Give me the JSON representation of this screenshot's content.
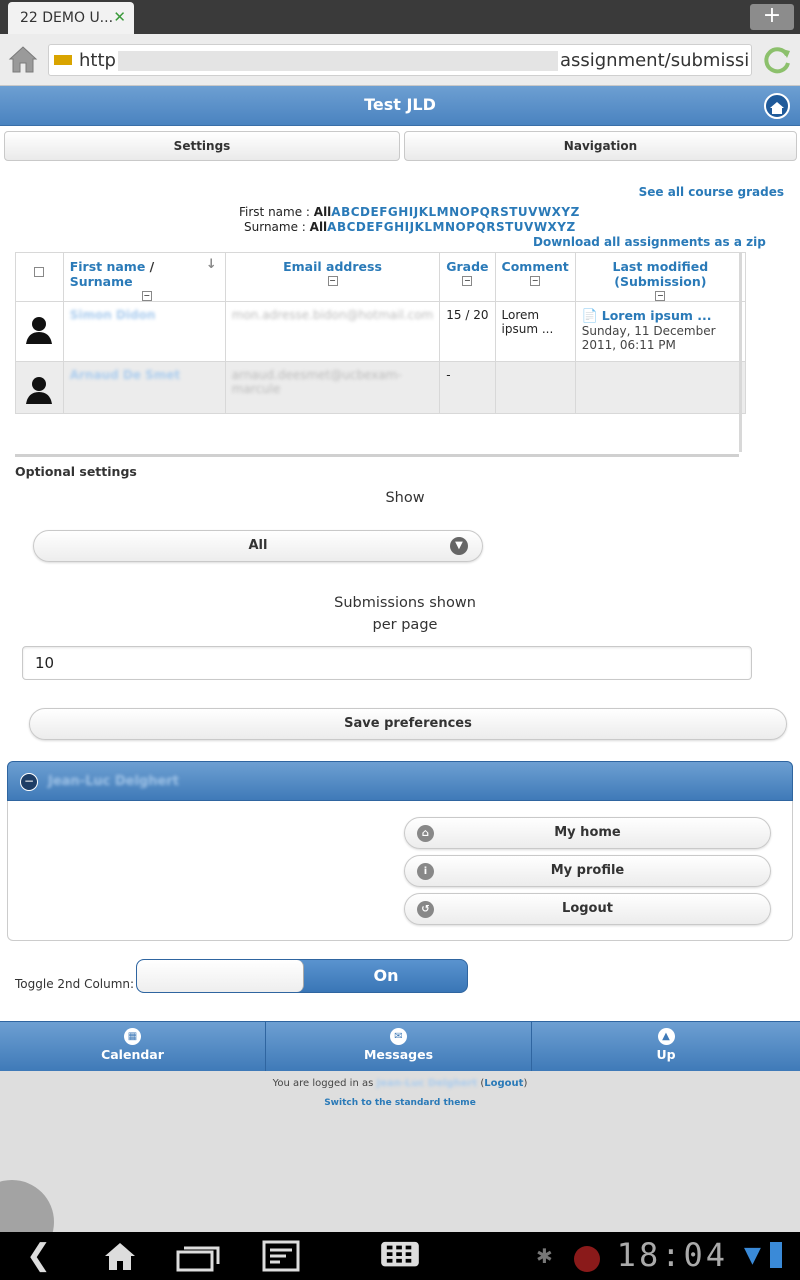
{
  "browser": {
    "tab_title": "22 DEMO U...",
    "tab_close": "✕",
    "new_tab": "+",
    "url_start": "http",
    "url_end": "assignment/submissi..."
  },
  "header": {
    "title": "Test JLD",
    "settings_label": "Settings",
    "navigation_label": "Navigation"
  },
  "links": {
    "course_grades": "See all course grades",
    "download_zip": "Download all assignments as a zip"
  },
  "filters": {
    "firstname_label": "First name : ",
    "surname_label": "Surname : ",
    "all": "All",
    "letters": "ABCDEFGHIJKLMNOPQRSTUVWXYZ"
  },
  "table": {
    "col_firstname": "First name",
    "col_sep": " / ",
    "col_surname": "Surname",
    "col_email": "Email address",
    "col_grade": "Grade",
    "col_comment": "Comment",
    "col_modified": "Last modified (Submission)",
    "collapse": "−",
    "rows": [
      {
        "name": "Simon Didon",
        "email": "mon.adresse.bidon@hotmail.com",
        "grade": "15 / 20",
        "comment": "Lorem ipsum ...",
        "submission_link": "Lorem ipsum ...",
        "submission_date": "Sunday, 11 December 2011, 06:11 PM"
      },
      {
        "name": "Arnaud De Smet",
        "email": "arnaud.deesmet@ucbexam-marcule",
        "grade": "-",
        "comment": "",
        "submission_link": "",
        "submission_date": ""
      }
    ]
  },
  "optional": {
    "title": "Optional settings",
    "show_label": "Show",
    "show_value": "All",
    "per_page_label_1": "Submissions shown",
    "per_page_label_2": "per page",
    "per_page_value": "10",
    "save_label": "Save preferences"
  },
  "user_block": {
    "name": "Jean-Luc Delghert",
    "my_home": "My home",
    "my_profile": "My profile",
    "logout": "Logout"
  },
  "toggle": {
    "label": "Toggle 2nd Column:",
    "state": "On"
  },
  "footer_nav": {
    "calendar": "Calendar",
    "messages": "Messages",
    "up": "Up"
  },
  "footer": {
    "logged_prefix": "You are logged in as ",
    "logged_user": "Jean-Luc Delghert",
    "logout_open": " (",
    "logout_link": "Logout",
    "logout_close": ")",
    "switch_theme": "Switch to the standard theme"
  },
  "system": {
    "clock": "18:04"
  },
  "colors": {
    "accent": "#4a83c0",
    "link": "#2a7ab8"
  }
}
